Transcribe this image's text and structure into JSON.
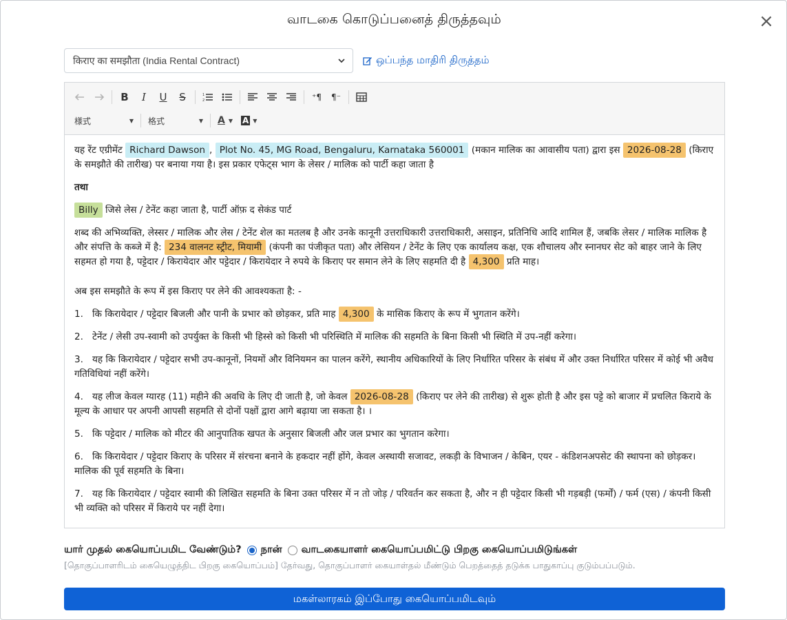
{
  "modal": {
    "title": "வாடகை கொடுப்பனைத் திருத்தவும்",
    "close_label": "×"
  },
  "template": {
    "selected": "किराए का समझौता (India Rental Contract)",
    "edit_link_label": "ஒப்பந்த மாதிரி திருத்தம்"
  },
  "toolbar": {
    "style_drop1": "様式",
    "style_drop2": "格式",
    "font_color_label": "A",
    "bg_color_label": "A"
  },
  "document": {
    "p1_a": "यह रेंट एग्रीमेंट",
    "landlord_name": "Richard Dawson",
    "p1_comma": ",",
    "landlord_address": "Plot No. 45, MG Road, Bengaluru, Karnataka 560001",
    "p1_b": "(मकान मालिक का आवासीय पता) द्वारा इस",
    "agreement_date": "2026-08-28",
    "p1_c": "(किराए के समझौते की तारीख) पर बनाया गया है। इस प्रकार एफेट्स भाग के लेसर / मालिक को पार्टी कहा जाता है",
    "and": "तथा",
    "tenant_name": "Billy",
    "p3": "जिसे लेस / टेनेंट कहा जाता है, पार्टी ऑफ़ द सेकंड पार्ट",
    "p4_a": "शब्द की अभिव्यक्ति, लेस्सर / मालिक और लेस / टेनेंट शेल का मतलब है और उनके कानूनी उत्तराधिकारी उत्तराधिकारी, असाइन, प्रतिनिधि आदि शामिल हैं, जबकि लेसर / मालिक मालिक है और संपत्ति के कब्जे में है:",
    "property_address": "234 वालनट स्ट्रीट, मियामी",
    "p4_b": "(कंपनी का पंजीकृत पता) और लेसियन / टेनेंट के लिए एक कार्यालय कक्ष, एक शौचालय और स्नानघर सेट को बाहर जाने के लिए सहमत हो गया है, पट्टेदार / किरायेदार और पट्टेदार / किरायेदार ने रुपये के किराए पर समान लेने के लिए सहमति दी है",
    "rent_amount": "4,300",
    "p4_c": "प्रति माह।",
    "p5": "अब इस समझौते के रूप में इस किराए पर लेने की आवश्यकता है: -",
    "items": [
      {
        "num": "1.",
        "a": "कि किरायेदार / पट्टेदार बिजली और पानी के प्रभार को छोड़कर, प्रति माह",
        "token": "4,300",
        "b": "के मासिक किराए के रूप में भुगतान करेंगे।"
      },
      {
        "num": "2.",
        "a": "टेनेंट / लेसी उप-स्वामी को उपर्युक्त के किसी भी हिस्से को किसी भी परिस्थिति में मालिक की सहमति के बिना किसी भी स्थिति में उप-नहीं करेगा।"
      },
      {
        "num": "3.",
        "a": "यह कि किरायेदार / पट्टेदार सभी उप-कानूनों, नियमों और विनियमन का पालन करेंगे, स्थानीय अधिकारियों के लिए निर्धारित परिसर के संबंध में और उक्त निर्धारित परिसर में कोई भी अवैध गतिविधियां नहीं करेंगे।"
      },
      {
        "num": "4.",
        "a": "यह लीज केवल ग्यारह (11) महीने की अवधि के लिए दी जाती है, जो केवल",
        "token": "2026-08-28",
        "b": "(किराए पर लेने की तारीख) से शुरू होती है और इस पट्टे को बाजार में प्रचलित किराये के मूल्य के आधार पर अपनी आपसी सहमति से दोनों पक्षों द्वारा आगे बढ़ाया जा सकता है। ।"
      },
      {
        "num": "5.",
        "a": "कि पट्टेदार / मालिक को मीटर की आनुपातिक खपत के अनुसार बिजली और जल प्रभार का भुगतान करेगा।"
      },
      {
        "num": "6.",
        "a": "कि किरायेदार / पट्टेदार किराए के परिसर में संरचना बनाने के हकदार नहीं होंगे, केवल अस्थायी सजावट, लकड़ी के विभाजन / केबिन, एयर - कंडिशनअपसेट की स्थापना को छोड़कर। मालिक की पूर्व सहमति के बिना।"
      },
      {
        "num": "7.",
        "a": "यह कि किरायेदार / पट्टेदार स्वामी की लिखित सहमति के बिना उक्त परिसर में न तो जोड़ / परिवर्तन कर सकता है, और न ही पट्टेदार किसी भी गड़बड़ी (फर्मों) / फर्म (एस) / कंपनी किसी भी व्यक्ति को परिसर में किराये पर नहीं देगा।"
      }
    ]
  },
  "signing": {
    "question": "யார் முதல் கையொப்பமிட வேண்டும்?",
    "option_me": "நான்",
    "option_landlord": "வாடகையாளர் கையொப்பமிட்டு பிறகு கையொப்பமிடுங்கள்",
    "selected": "me",
    "hint": "[தொகுப்பாளரிடம் கையெழுத்திட பிறகு கையொப்பம்] தேர்வது, தொகுப்பாளர் கையாள்தல் மீண்டும் பெறத்தைத் தடுக்க பாதுகாப்பு குடும்பப்படும்.",
    "submit_label": "மகள்லாரகம் இப்போது கையொப்பமிடவும்"
  },
  "colors": {
    "primary": "#0f62d6",
    "link": "#1a64c8",
    "token_blue": "#c9edf5",
    "token_orange": "#f5c36e",
    "token_green": "#c6df9a"
  }
}
